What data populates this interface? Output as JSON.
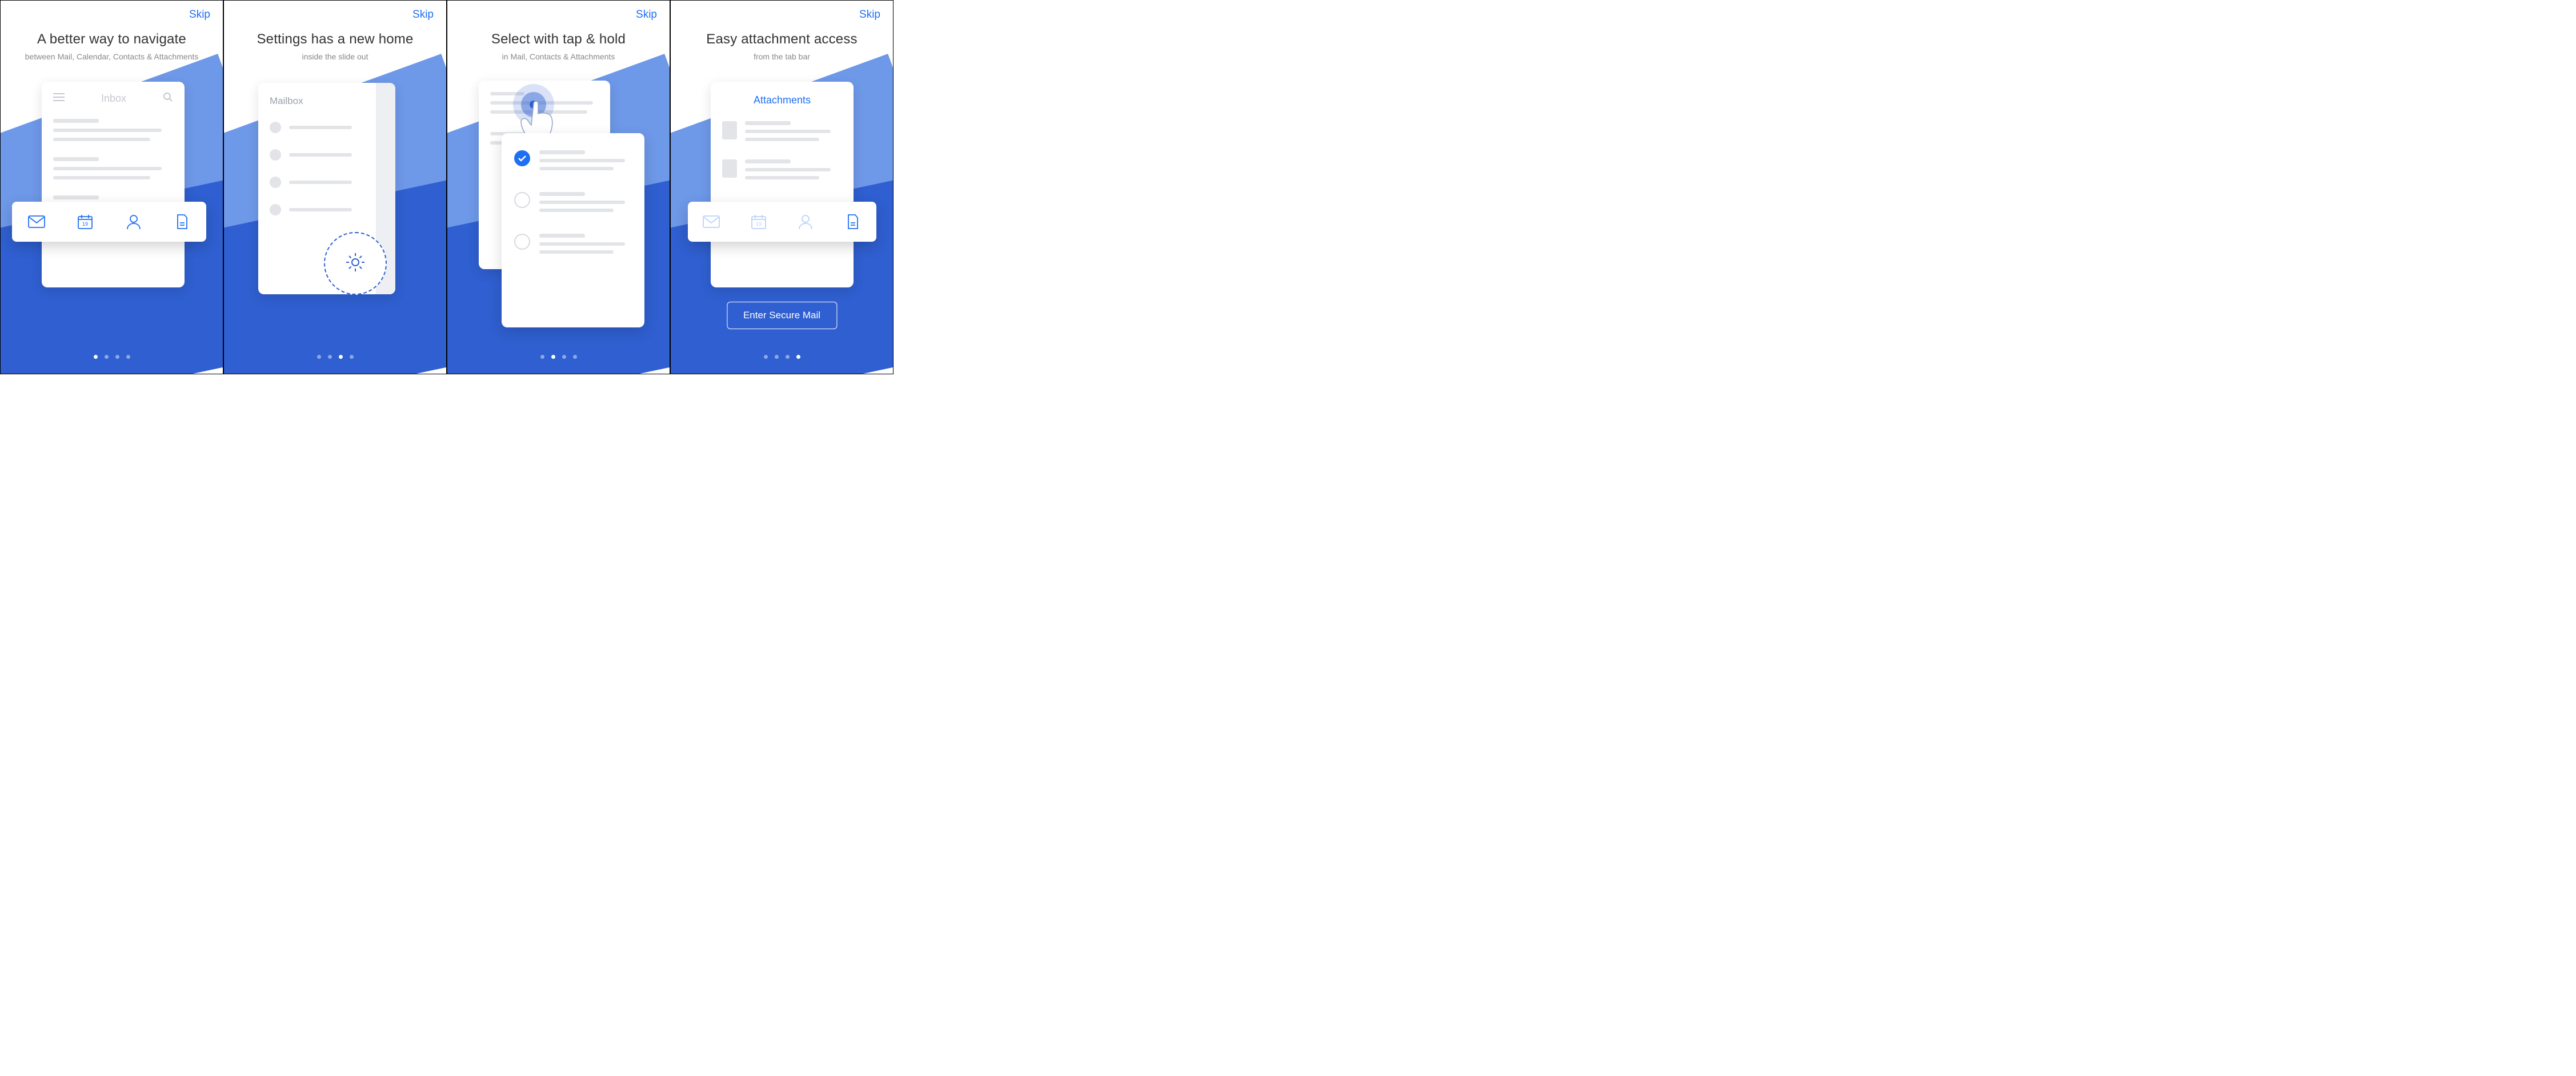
{
  "skip_label": "Skip",
  "calendar_day": "19",
  "screens": [
    {
      "title": "A better way to navigate",
      "subtitle": "between Mail, Calendar, Contacts & Attachments",
      "inbox_label": "Inbox",
      "active_dot": 0
    },
    {
      "title": "Settings has a new home",
      "subtitle": "inside the slide out",
      "mailbox_label": "Mailbox",
      "active_dot": 2
    },
    {
      "title": "Select with tap & hold",
      "subtitle": "in Mail, Contacts & Attachments",
      "active_dot": 1
    },
    {
      "title": "Easy attachment access",
      "subtitle": "from the tab bar",
      "attachments_label": "Attachments",
      "enter_label": "Enter Secure Mail",
      "active_dot": 3
    }
  ],
  "tab_icons": [
    "mail-icon",
    "calendar-icon",
    "contacts-icon",
    "attachments-icon"
  ],
  "colors": {
    "accent": "#1e6ff2",
    "bg_light": "#6e98e8",
    "bg_dark": "#2f5fd0"
  }
}
